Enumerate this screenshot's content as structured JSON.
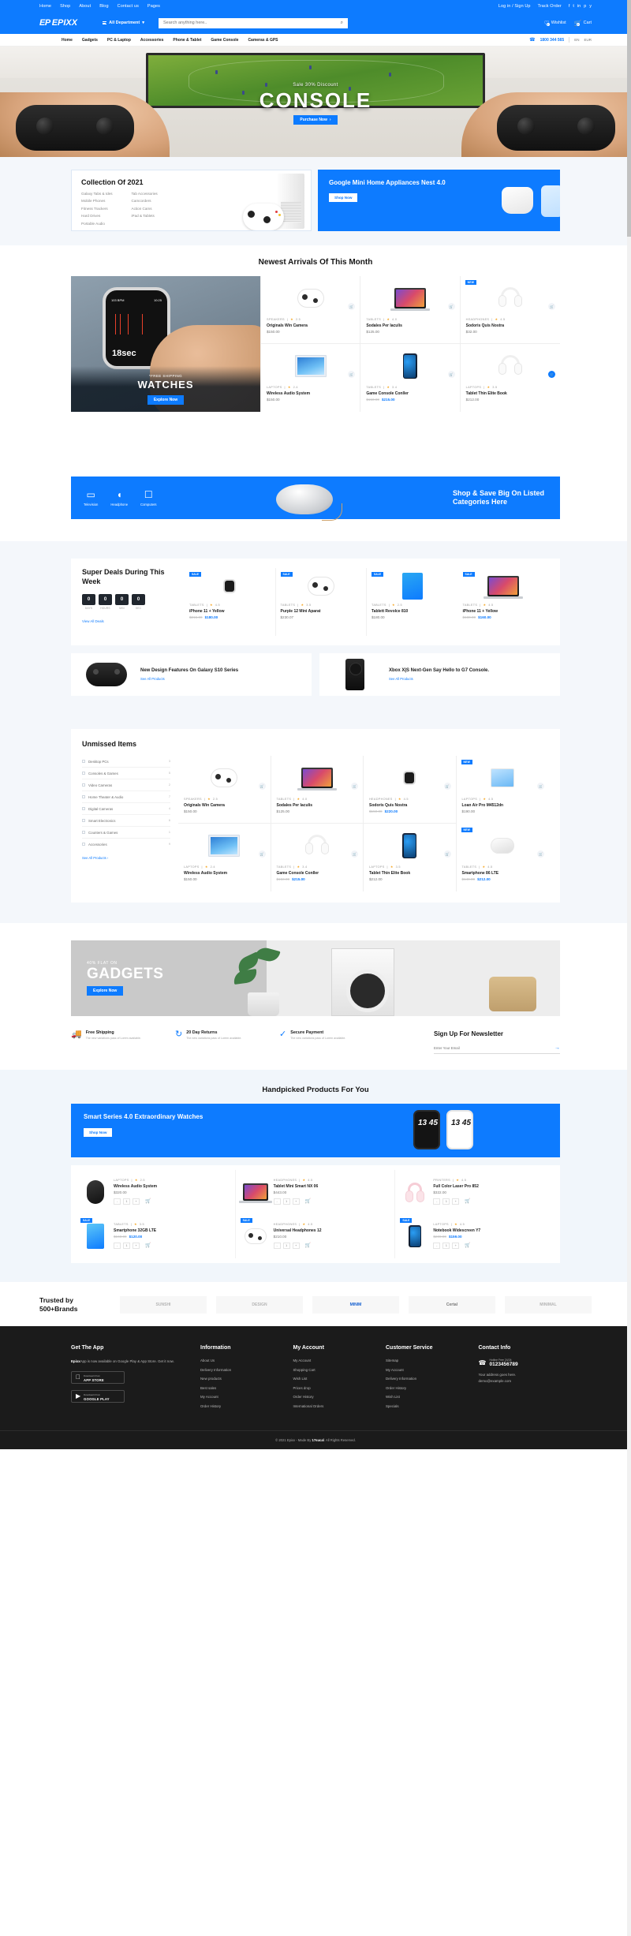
{
  "topbar": {
    "nav": [
      "Home",
      "Shop",
      "About",
      "Blog",
      "Contact us",
      "Pages"
    ],
    "login": "Log in / Sign Up",
    "track": "Track Order",
    "social": [
      "f",
      "t",
      "in",
      "p",
      "y"
    ]
  },
  "header": {
    "logo_mark": "EP",
    "logo_text": "EPIXX",
    "department": "All Department",
    "search_placeholder": "Search anything here..",
    "wishlist": "Wishlist",
    "wishlist_count": "0",
    "cart": "Cart",
    "cart_count": "0"
  },
  "nav": {
    "items": [
      "Home",
      "Gadgets",
      "PC & Laptop",
      "Accessories",
      "Phone & Tablet",
      "Game Console",
      "Cameras & GPS"
    ],
    "phone": "1800 344 565",
    "lang": "EN",
    "currency": "EUR"
  },
  "hero": {
    "sale": "Sale 30% Discount",
    "title": "CONSOLE",
    "cta": "Purchase Now"
  },
  "collection": {
    "title": "Collection Of 2021",
    "col1": [
      "Galaxy Tabs & Ides",
      "Mobile Phones",
      "Fitness Trackers",
      "Hard Drives",
      "Portable Audio"
    ],
    "col2": [
      "Tab Accessories",
      "Camcorders",
      "Action Cams",
      "iPad & Tablets"
    ],
    "promo_title": "Google Mini Home Appliances Nest 4.0",
    "promo_cta": "Shop Now"
  },
  "arrivals": {
    "section_title": "Newest Arrivals Of This Month",
    "feature": {
      "bpm": "103 BPM",
      "time": "10:25",
      "seconds": "18sec",
      "shipping": "*FREE SHIPPING",
      "title": "WATCHES",
      "cta": "Explore Now"
    },
    "products": [
      {
        "cat": "SPEAKERS",
        "rating": "2.5",
        "name": "Originals Win Camera",
        "price": "$150.00",
        "old": "",
        "tag": "",
        "img": "controller-icon",
        "cart_active": false
      },
      {
        "cat": "TABLETS",
        "rating": "4.0",
        "name": "Sodales Per Iaculis",
        "price": "$125.00",
        "old": "",
        "tag": "",
        "img": "laptop-icon",
        "cart_active": false
      },
      {
        "cat": "HEADPHONES",
        "rating": "4.5",
        "name": "Sodoris Quis Nostra",
        "price": "$32.00",
        "old": "",
        "tag": "NEW",
        "img": "headphone-icon",
        "cart_active": false
      },
      {
        "cat": "LAPTOPS",
        "rating": "2.4",
        "name": "Wireless Audio System",
        "price": "$150.00",
        "old": "",
        "tag": "",
        "img": "monitor-icon",
        "cart_active": false
      },
      {
        "cat": "TABLETS",
        "rating": "3.4",
        "name": "Game Console Conller",
        "price": "$215.00",
        "old": "$150.00",
        "tag": "",
        "img": "phone-icon",
        "cart_active": false
      },
      {
        "cat": "LAPTOPS",
        "rating": "3.5",
        "name": "Tablet Thin Elite Book",
        "price": "$212.00",
        "old": "",
        "tag": "",
        "img": "headphone-icon",
        "cart_active": true
      }
    ]
  },
  "promo_bar": {
    "categories": [
      {
        "icon": "tv-icon",
        "glyph": "▭",
        "label": "Television"
      },
      {
        "icon": "headphone-icon",
        "glyph": "◖",
        "label": "Headphone"
      },
      {
        "icon": "computer-icon",
        "glyph": "☐",
        "label": "Computers"
      }
    ],
    "headline": "Shop & Save Big On Listed Categories Here"
  },
  "super_deals": {
    "title": "Super Deals During This Week",
    "timer": [
      {
        "num": "0",
        "label": "DAYS"
      },
      {
        "num": "0",
        "label": "HOURS"
      },
      {
        "num": "0",
        "label": "MIN"
      },
      {
        "num": "0",
        "label": "SEC"
      }
    ],
    "view_all": "View All Deals",
    "products": [
      {
        "cat": "TABLETS",
        "rating": "4.5",
        "name": "iPhone 11 + Yellow",
        "price": "$180.00",
        "old": "$215.00",
        "tag": "SALE",
        "img": "watch-icon"
      },
      {
        "cat": "TABLETS",
        "rating": "3.5",
        "name": "Purple 12 Mini Aparat",
        "price": "$230.07",
        "old": "",
        "tag": "SALE",
        "img": "controller-icon"
      },
      {
        "cat": "TABLETS",
        "rating": "2.5",
        "name": "Tablett Revolce 810",
        "price": "$180.00",
        "old": "",
        "tag": "SALE",
        "img": "tablet-icon"
      },
      {
        "cat": "TABLETS",
        "rating": "4.5",
        "name": "iPhone 11 + Yellow",
        "price": "$160.00",
        "old": "$180.00",
        "tag": "SALE",
        "img": "laptop-icon"
      }
    ],
    "banners": [
      {
        "title": "New Design Features On Galaxy S10 Series",
        "link": "See All Products",
        "img": "controller-icon"
      },
      {
        "title": "Xbox X|S Next-Gen Say Hello to G7 Console.",
        "link": "See All Products",
        "img": "console-icon"
      }
    ]
  },
  "unmissed": {
    "title": "Unmissed Items",
    "categories": [
      {
        "label": "Desktop PCs",
        "count": "3"
      },
      {
        "label": "Consoles & Games",
        "count": "5"
      },
      {
        "label": "Video Cameras",
        "count": "2"
      },
      {
        "label": "Home Theater & Audio",
        "count": "7"
      },
      {
        "label": "Digital Cameras",
        "count": "4"
      },
      {
        "label": "Smart Electronics",
        "count": "6"
      },
      {
        "label": "Counters & Games",
        "count": "1"
      },
      {
        "label": "Accessories",
        "count": "9"
      }
    ],
    "see_all": "See All Products",
    "products": [
      {
        "cat": "SPEAKERS",
        "rating": "2.5",
        "name": "Originals Win Camera",
        "price": "$150.00",
        "old": "",
        "tag": "",
        "img": "controller-icon"
      },
      {
        "cat": "TABLETS",
        "rating": "4.0",
        "name": "Sodales Per Iaculis",
        "price": "$125.00",
        "old": "",
        "tag": "",
        "img": "laptop-icon"
      },
      {
        "cat": "HEADPHONES",
        "rating": "4.5",
        "name": "Sodoris Quis Nostra",
        "price": "$220.00",
        "old": "$150.00",
        "tag": "",
        "img": "watch-icon"
      },
      {
        "cat": "LAPTOPS",
        "rating": "4.5",
        "name": "Loan Air Pro M4512dn",
        "price": "$190.00",
        "old": "",
        "tag": "NEW",
        "img": "tablet-icon"
      },
      {
        "cat": "LAPTOPS",
        "rating": "2.4",
        "name": "Wireless Audio System",
        "price": "$150.00",
        "old": "",
        "tag": "",
        "img": "monitor-icon"
      },
      {
        "cat": "TABLETS",
        "rating": "3.4",
        "name": "Game Console Conller",
        "price": "$215.00",
        "old": "$150.00",
        "tag": "",
        "img": "headphone-icon"
      },
      {
        "cat": "LAPTOPS",
        "rating": "3.5",
        "name": "Tablet Thin Elite Book",
        "price": "$212.00",
        "old": "",
        "tag": "",
        "img": "phone-icon"
      },
      {
        "cat": "TABLETS",
        "rating": "4.5",
        "name": "Smartphone 86 LTE",
        "price": "$212.00",
        "old": "$140.00",
        "tag": "NEW",
        "img": "speaker-icon"
      }
    ]
  },
  "gadgets_banner": {
    "small": "40% FLAT ON",
    "big": "GADGETS",
    "cta": "Explore Now"
  },
  "features": [
    {
      "icon": "truck-icon",
      "glyph": "🚚",
      "title": "Free Shipping",
      "text": "The new variations pass of Lorem available."
    },
    {
      "icon": "refresh-icon",
      "glyph": "↻",
      "title": "20 Day Returns",
      "text": "The new variations pass of Lorem available."
    },
    {
      "icon": "shield-icon",
      "glyph": "✓",
      "title": "Secure Payment",
      "text": "The new variations pass of Lorem available."
    }
  ],
  "newsletter": {
    "title": "Sign Up For Newsletter",
    "placeholder": "Enter Your Email",
    "submit": "→"
  },
  "handpicked": {
    "title": "Handpicked Products For You",
    "banner": {
      "title": "Smart Series 4.0 Extraordinary Watches",
      "cta": "Shop Now",
      "watch1": "13 45",
      "watch2": "13 45"
    },
    "products": [
      {
        "cat": "LAPTOPS",
        "rating": "2.5",
        "name": "Wireless Audio System",
        "price": "$320.00",
        "old": "",
        "tag": "",
        "qty": "1",
        "img": "speaker-icon"
      },
      {
        "cat": "HEADPHONES",
        "rating": "4.5",
        "name": "Tablet Mini Smart NX 06",
        "price": "$443.00",
        "old": "",
        "tag": "",
        "qty": "1",
        "img": "laptop-icon"
      },
      {
        "cat": "PRINTERS",
        "rating": "4.5",
        "name": "Full Color Laser Pro 852",
        "price": "$322.00",
        "old": "",
        "tag": "",
        "qty": "1",
        "img": "headphone-icon"
      },
      {
        "cat": "TABLETS",
        "rating": "3.5",
        "name": "Smartphone 32GB LTE",
        "price": "$120.00",
        "old": "$160.00",
        "tag": "SALE",
        "qty": "1",
        "img": "tablet-icon"
      },
      {
        "cat": "HEADPHONES",
        "rating": "4.5",
        "name": "Universal Headphones 12",
        "price": "$210.00",
        "old": "",
        "tag": "SALE",
        "qty": "1",
        "img": "controller-icon"
      },
      {
        "cat": "LAPTOPS",
        "rating": "4.5",
        "name": "Notebook Widescreen Y7",
        "price": "$159.00",
        "old": "$200.00",
        "tag": "SALE",
        "qty": "1",
        "img": "phone-icon"
      }
    ]
  },
  "brands": {
    "title": "Trusted by 500+Brands",
    "logos": [
      "SUNSHI",
      "DESIGN",
      "MINIM",
      "Certal",
      "MINIMAL"
    ]
  },
  "footer": {
    "app": {
      "title": "Get The App",
      "text_brand": "Epixx",
      "text": "App is now available on Google Play & App Store. Get it now.",
      "store1_small": "Download it from",
      "store1_big": "APP STORE",
      "store2_small": "Download it from",
      "store2_big": "GOOGLE PLAY"
    },
    "information": {
      "title": "Information",
      "items": [
        "About Us",
        "Delivery Information",
        "New products",
        "Best sales",
        "My Account",
        "Order History"
      ]
    },
    "my_account": {
      "title": "My Account",
      "items": [
        "My Account",
        "Shopping Cart",
        "Wish List",
        "Prices drop",
        "Order History",
        "International Orders"
      ]
    },
    "customer_service": {
      "title": "Customer Service",
      "items": [
        "Sitemap",
        "My Account",
        "Delivery Information",
        "Order History",
        "Wish List",
        "Specials"
      ]
    },
    "contact": {
      "title": "Contact Info",
      "toll_label": "Hotline Free 24/24:",
      "phone": "0123456789",
      "address": "Your address goes here.",
      "email": "demo@example.com"
    },
    "copyright_pre": "© 2021 Epixx - Made By ",
    "copyright_brand": "17sucal",
    "copyright_post": ". All Rights Reserved."
  },
  "colors": {
    "brand_blue": "#0d7bff",
    "dark": "#1b1b1b",
    "band": "#f4f7fb"
  }
}
